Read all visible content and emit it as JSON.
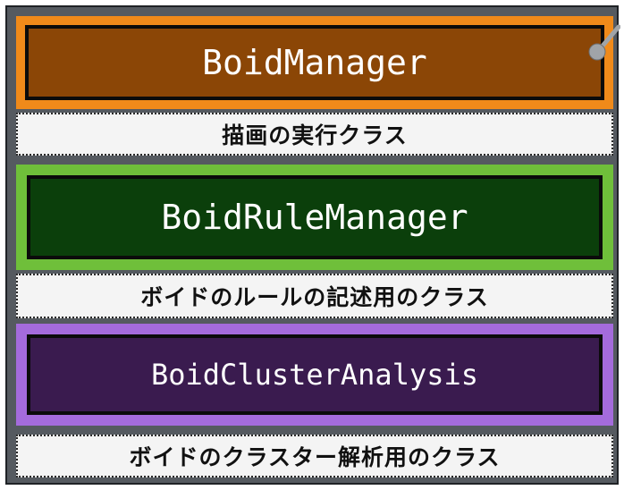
{
  "boxes": [
    {
      "label": "BoidManager",
      "outer_color": "#f08a1a",
      "inner_color": "#8b4606",
      "text_color": "#ffffff"
    },
    {
      "label": "BoidRuleManager",
      "outer_color": "#6fbf3a",
      "inner_color": "#0b3f0b",
      "text_color": "#ffffff"
    },
    {
      "label": "BoidClusterAnalysis",
      "outer_color": "#a46bdc",
      "inner_color": "#3a1b4f",
      "text_color": "#ffffff"
    }
  ],
  "captions": [
    "描画の実行クラス",
    "ボイドのルールの記述用のクラス",
    "ボイドのクラスター解析用のクラス"
  ],
  "colors": {
    "panel_bg": "#555a60",
    "caption_bg": "#f4f4f4",
    "connector": "#a0a4a8"
  }
}
